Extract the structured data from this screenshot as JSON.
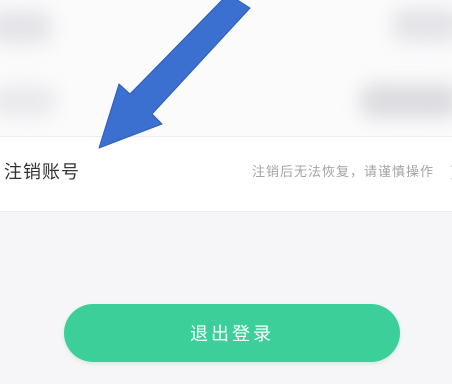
{
  "account_row": {
    "label": "注销账号",
    "hint": "注销后无法恢复，请谨慎操作"
  },
  "logout_button": {
    "label": "退出登录"
  },
  "colors": {
    "accent": "#3ccf9a",
    "annotation_arrow": "#3b6fd0"
  },
  "icons": {
    "row_chevron": "chevron-right-icon",
    "annotation": "arrow-annotation-icon"
  }
}
